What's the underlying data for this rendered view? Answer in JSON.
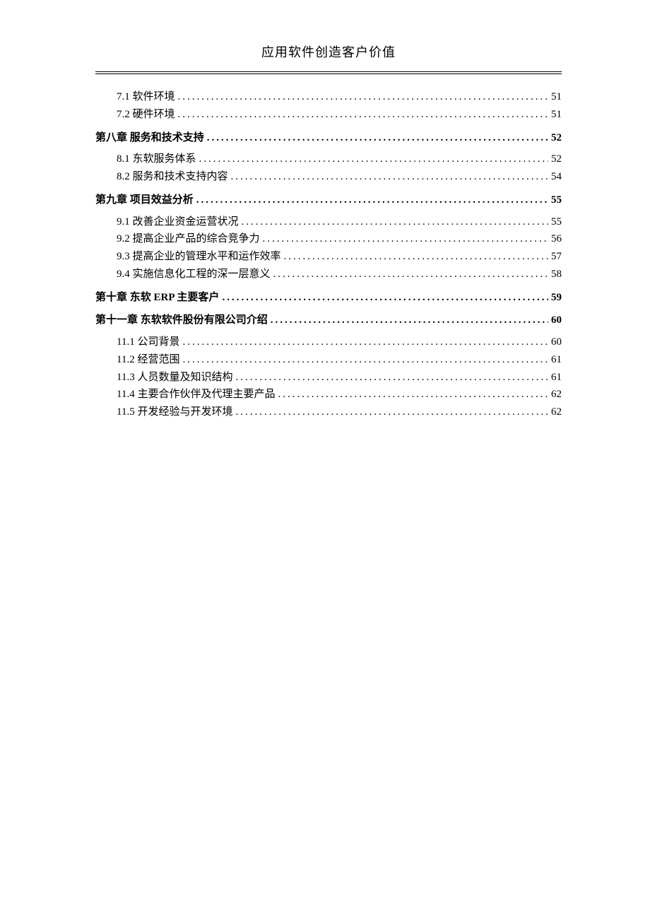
{
  "header": {
    "title": "应用软件创造客户价值"
  },
  "toc": {
    "pre_subsections": [
      {
        "label": "7.1 软件环境",
        "page": "51"
      },
      {
        "label": "7.2 硬件环境",
        "page": "51"
      }
    ],
    "chapters": [
      {
        "label": "第八章 服务和技术支持",
        "page": "52",
        "subsections": [
          {
            "label": "8.1 东软服务体系",
            "page": "52"
          },
          {
            "label": "8.2 服务和技术支持内容",
            "page": "54"
          }
        ]
      },
      {
        "label": "第九章 项目效益分析",
        "page": "55",
        "subsections": [
          {
            "label": "9.1 改善企业资金运营状况",
            "page": "55"
          },
          {
            "label": "9.2 提高企业产品的综合竞争力",
            "page": "56"
          },
          {
            "label": "9.3 提高企业的管理水平和运作效率",
            "page": "57"
          },
          {
            "label": "9.4 实施信息化工程的深一层意义",
            "page": "58"
          }
        ]
      },
      {
        "label": "第十章 东软 ERP 主要客户",
        "page": "59",
        "subsections": []
      },
      {
        "label": "第十一章 东软软件股份有限公司介绍",
        "page": "60",
        "subsections": [
          {
            "label": "11.1 公司背景",
            "page": "60"
          },
          {
            "label": "11.2 经营范围",
            "page": "61"
          },
          {
            "label": "11.3 人员数量及知识结构",
            "page": "61"
          },
          {
            "label": "11.4 主要合作伙伴及代理主要产品",
            "page": "62"
          },
          {
            "label": "11.5 开发经验与开发环境",
            "page": "62"
          }
        ]
      }
    ]
  }
}
